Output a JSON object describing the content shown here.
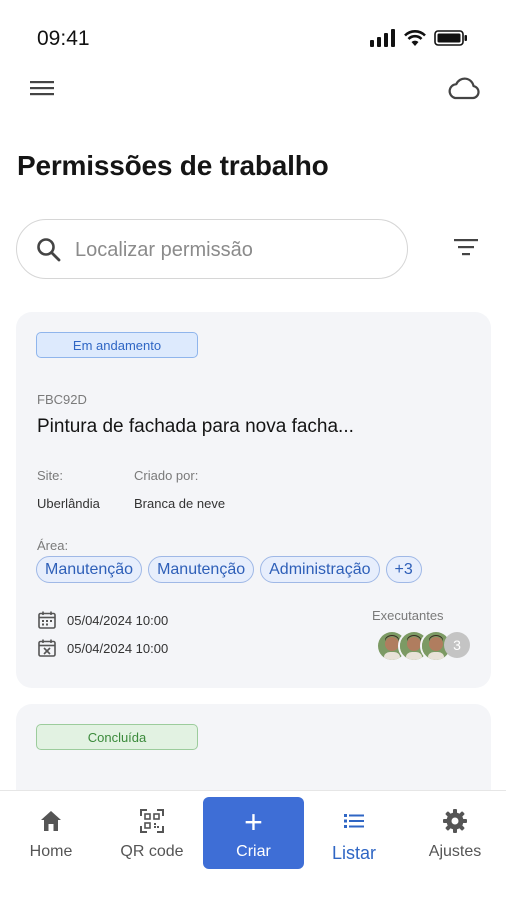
{
  "status_bar": {
    "time": "09:41"
  },
  "page": {
    "title": "Permissões de trabalho"
  },
  "search": {
    "placeholder": "Localizar permissão",
    "value": ""
  },
  "cards": [
    {
      "status": "Em andamento",
      "code": "FBC92D",
      "title": "Pintura de fachada para nova facha...",
      "site_label": "Site:",
      "site_value": "Uberlândia",
      "created_label": "Criado por:",
      "created_value": "Branca de neve",
      "area_label": "Área:",
      "areas": [
        "Manutenção",
        "Manutenção",
        "Administração",
        "+3"
      ],
      "start_date": "05/04/2024 10:00",
      "end_date": "05/04/2024 10:00",
      "executors_label": "Executantes",
      "executors_more": "3"
    },
    {
      "status": "Concluída"
    }
  ],
  "bottom_nav": {
    "items": [
      {
        "label": "Home",
        "icon": "home-icon"
      },
      {
        "label": "QR code",
        "icon": "qr-code-icon"
      },
      {
        "label": "Criar",
        "icon": "plus-icon"
      },
      {
        "label": "Listar",
        "icon": "list-icon"
      },
      {
        "label": "Ajustes",
        "icon": "gear-icon"
      }
    ],
    "active": "Listar"
  },
  "colors": {
    "accent": "#3e6ed6",
    "badge_progress": "#ddeafd",
    "badge_done": "#e2f2e2",
    "card_bg": "#f4f5f8"
  }
}
